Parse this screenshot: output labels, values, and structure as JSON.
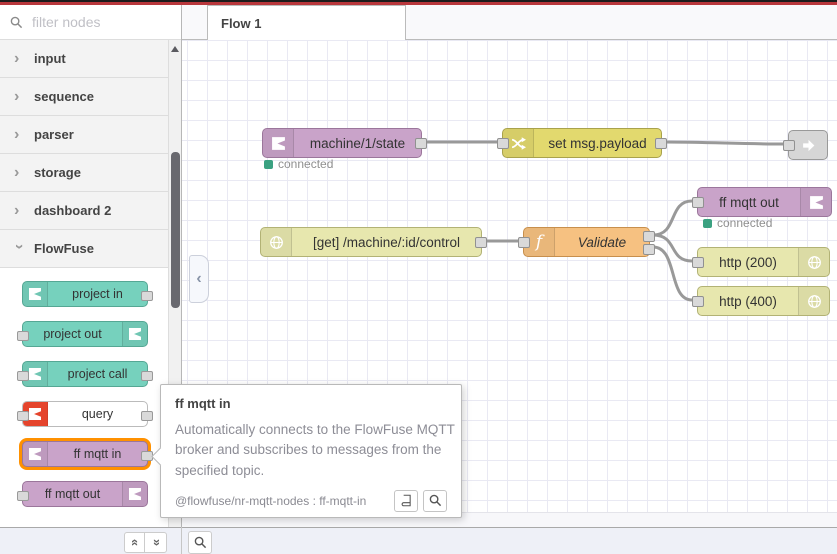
{
  "palette": {
    "search_placeholder": "filter nodes",
    "categories": [
      {
        "label": "input"
      },
      {
        "label": "sequence"
      },
      {
        "label": "parser"
      },
      {
        "label": "storage"
      },
      {
        "label": "dashboard 2"
      },
      {
        "label": "FlowFuse"
      }
    ],
    "nodes": [
      {
        "label": "project in"
      },
      {
        "label": "project out"
      },
      {
        "label": "project call"
      },
      {
        "label": "query"
      },
      {
        "label": "ff mqtt in"
      },
      {
        "label": "ff mqtt out"
      }
    ]
  },
  "workspace": {
    "tab_label": "Flow 1"
  },
  "flow": {
    "mqtt_in": {
      "label": "machine/1/state",
      "status": "connected"
    },
    "change": {
      "label": "set msg.payload"
    },
    "http_in": {
      "label": "[get] /machine/:id/control"
    },
    "function": {
      "label": "Validate"
    },
    "mqtt_out": {
      "label": "ff mqtt out",
      "status": "connected"
    },
    "http_res_200": {
      "label": "http (200)"
    },
    "http_res_400": {
      "label": "http (400)"
    }
  },
  "tooltip": {
    "title": "ff mqtt in",
    "body": "Automatically connects to the FlowFuse MQTT broker and subscribes to messages from the specified topic.",
    "meta": "@flowfuse/nr-mqtt-nodes : ff-mqtt-in"
  },
  "colors": {
    "accent-red": "#b8373c",
    "node-purple": "#c9a3c9",
    "node-teal": "#76d1bd",
    "node-yellow": "#e2d96e",
    "node-olive": "#e7e7ae",
    "node-orange": "#f6c181",
    "node-gray": "#d6d6d6",
    "query-orange": "#e5442c",
    "highlight-orange": "#ff9100",
    "status-green": "#3aa181",
    "wire-gray": "#999999"
  }
}
